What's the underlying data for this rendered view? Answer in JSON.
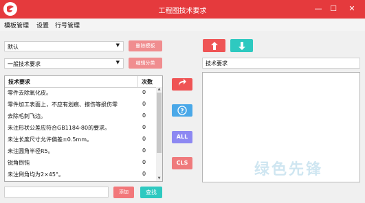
{
  "window": {
    "title": "工程图技术要求",
    "controls": {
      "minimize": "—",
      "maximize": "☐",
      "close": "✕"
    }
  },
  "menu": [
    "模板管理",
    "设置",
    "行号管理"
  ],
  "template_select": {
    "value": "默认"
  },
  "delete_template_label": "删除模板",
  "category_select": {
    "value": "一般技术要求"
  },
  "edit_category_label": "编辑分类",
  "table": {
    "headers": {
      "name": "技术要求",
      "count": "次数"
    },
    "rows": [
      {
        "name": "零件去除氧化皮。",
        "count": "0"
      },
      {
        "name": "零件加工表面上，不应有划痕、擦伤等损伤零",
        "count": "0"
      },
      {
        "name": "去除毛刺飞边。",
        "count": "0"
      },
      {
        "name": "未注形状公差应符合GB1184-80的要求。",
        "count": "0"
      },
      {
        "name": "未注长度尺寸允许偏差±0.5mm。",
        "count": "0"
      },
      {
        "name": "未注圆角半径R5。",
        "count": "0"
      },
      {
        "name": "锐角倒钝",
        "count": "0"
      },
      {
        "name": "未注倒角均为2×45°。",
        "count": "0"
      }
    ]
  },
  "search_input": {
    "value": "",
    "placeholder": ""
  },
  "add_label": "添加",
  "find_label": "查找",
  "middle_buttons": {
    "insert_icon": "arrow-redo-icon",
    "help_icon": "question-icon",
    "all_label": "ALL",
    "cls_label": "CLS"
  },
  "right": {
    "up_icon": "arrow-up-icon",
    "down_icon": "arrow-down-icon",
    "heading_value": "技术要求",
    "textarea_value": ""
  },
  "watermark": "绿色先锋",
  "colors": {
    "accent": "#e53a3d",
    "pink": "#f08d8f",
    "teal": "#2ec9c0",
    "blue": "#4aa8e8",
    "purple": "#8d88f2",
    "red": "#ef5455"
  }
}
